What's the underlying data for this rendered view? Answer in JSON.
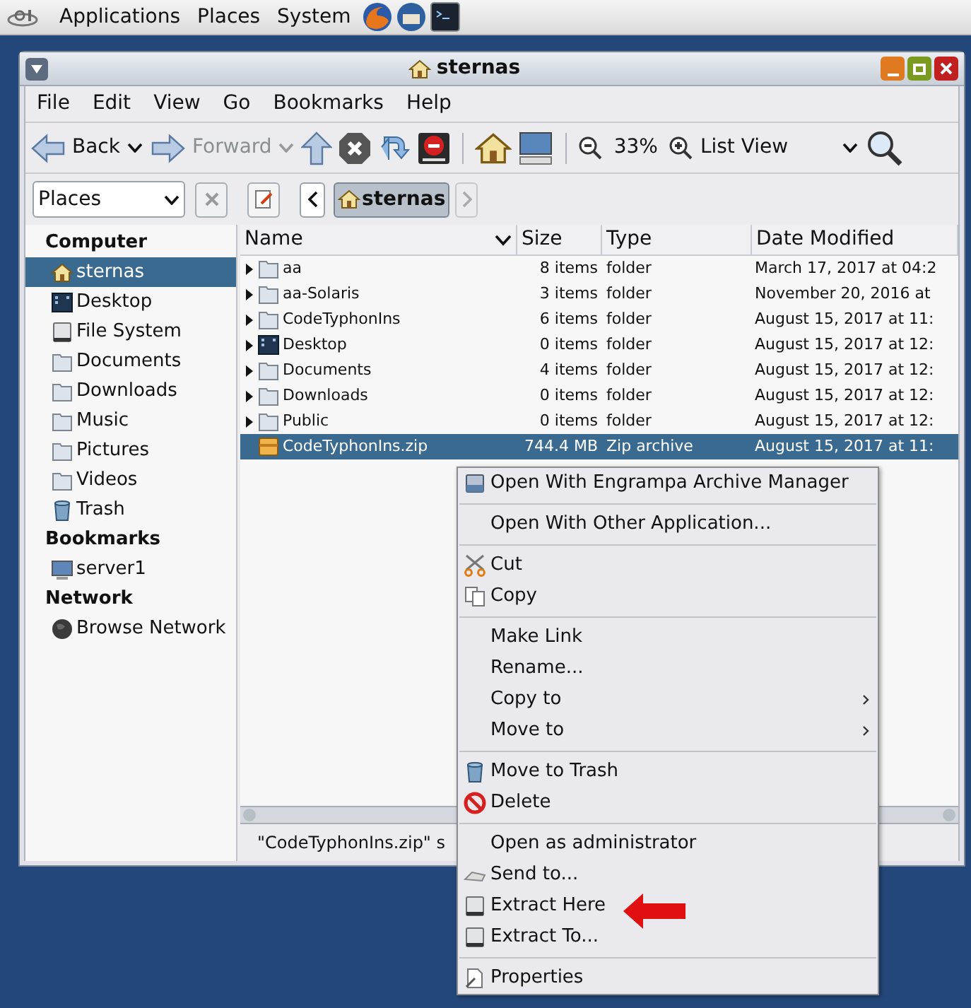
{
  "top_panel": {
    "menus": [
      "Applications",
      "Places",
      "System"
    ]
  },
  "window": {
    "title": "sternas"
  },
  "menubar": [
    "File",
    "Edit",
    "View",
    "Go",
    "Bookmarks",
    "Help"
  ],
  "toolbar": {
    "back": {
      "label": "Back",
      "disabled": false
    },
    "forward": {
      "label": "Forward",
      "disabled": true
    },
    "zoom": "33%",
    "view": "List View"
  },
  "location": {
    "places": "Places",
    "crumb": "sternas"
  },
  "sidebar": [
    {
      "heading": "Computer",
      "items": [
        {
          "label": "sternas",
          "kind": "home",
          "selected": true
        },
        {
          "label": "Desktop",
          "kind": "desktop",
          "selected": false
        },
        {
          "label": "File System",
          "kind": "drive",
          "selected": false
        },
        {
          "label": "Documents",
          "kind": "folder",
          "selected": false
        },
        {
          "label": "Downloads",
          "kind": "folder",
          "selected": false
        },
        {
          "label": "Music",
          "kind": "folder",
          "selected": false
        },
        {
          "label": "Pictures",
          "kind": "folder",
          "selected": false
        },
        {
          "label": "Videos",
          "kind": "folder",
          "selected": false
        },
        {
          "label": "Trash",
          "kind": "trash",
          "selected": false
        }
      ]
    },
    {
      "heading": "Bookmarks",
      "items": [
        {
          "label": "server1",
          "kind": "monitor",
          "selected": false
        }
      ]
    },
    {
      "heading": "Network",
      "items": [
        {
          "label": "Browse Network",
          "kind": "globe",
          "selected": false
        }
      ]
    }
  ],
  "table": {
    "columns": [
      "Name",
      "Size",
      "Type",
      "Date Modified"
    ],
    "rows": [
      {
        "name": "aa",
        "size": "8 items",
        "type": "folder",
        "date": "March 17, 2017 at 04:2",
        "kind": "folder",
        "selected": false
      },
      {
        "name": "aa-Solaris",
        "size": "3 items",
        "type": "folder",
        "date": "November 20, 2016 at",
        "kind": "folder",
        "selected": false
      },
      {
        "name": "CodeTyphonIns",
        "size": "6 items",
        "type": "folder",
        "date": "August 15, 2017 at 11:",
        "kind": "folder",
        "selected": false
      },
      {
        "name": "Desktop",
        "size": "0 items",
        "type": "folder",
        "date": "August 15, 2017 at 12:",
        "kind": "desktop",
        "selected": false
      },
      {
        "name": "Documents",
        "size": "4 items",
        "type": "folder",
        "date": "August 15, 2017 at 12:",
        "kind": "folder",
        "selected": false
      },
      {
        "name": "Downloads",
        "size": "0 items",
        "type": "folder",
        "date": "August 15, 2017 at 12:",
        "kind": "folder",
        "selected": false
      },
      {
        "name": "Public",
        "size": "0 items",
        "type": "folder",
        "date": "August 15, 2017 at 12:",
        "kind": "folder",
        "selected": false
      },
      {
        "name": "CodeTyphonIns.zip",
        "size": "744.4 MB",
        "type": "Zip archive",
        "date": "August 15, 2017 at 11:",
        "kind": "zip",
        "selected": true
      }
    ]
  },
  "status_bar": "\"CodeTyphonIns.zip\" s",
  "context_menu": {
    "groups": [
      [
        {
          "label": "Open With Engrampa Archive Manager",
          "kind": "archive",
          "submenu": false
        }
      ],
      [
        {
          "label": "Open With Other Application...",
          "kind": "none",
          "submenu": false
        }
      ],
      [
        {
          "label": "Cut",
          "kind": "scissors",
          "submenu": false
        },
        {
          "label": "Copy",
          "kind": "copy",
          "submenu": false
        }
      ],
      [
        {
          "label": "Make Link",
          "kind": "none",
          "submenu": false
        },
        {
          "label": "Rename...",
          "kind": "none",
          "submenu": false
        },
        {
          "label": "Copy to",
          "kind": "none",
          "submenu": true
        },
        {
          "label": "Move to",
          "kind": "none",
          "submenu": true
        }
      ],
      [
        {
          "label": "Move to Trash",
          "kind": "trash",
          "submenu": false
        },
        {
          "label": "Delete",
          "kind": "delete",
          "submenu": false
        }
      ],
      [
        {
          "label": "Open as administrator",
          "kind": "none",
          "submenu": false
        },
        {
          "label": "Send to...",
          "kind": "send",
          "submenu": false
        },
        {
          "label": "Extract Here",
          "kind": "drive",
          "submenu": false
        },
        {
          "label": "Extract To...",
          "kind": "drive",
          "submenu": false
        }
      ],
      [
        {
          "label": "Properties",
          "kind": "properties",
          "submenu": false
        }
      ]
    ]
  }
}
